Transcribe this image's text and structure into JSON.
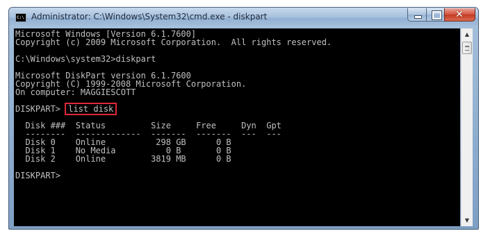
{
  "window": {
    "title": "Administrator: C:\\Windows\\System32\\cmd.exe - diskpart",
    "icon": "cmd-icon",
    "icon_label": "C:\\",
    "controls": {
      "minimize_icon": "minimize-icon",
      "maximize_icon": "maximize-icon",
      "close_icon": "close-icon",
      "close_glyph": "✕"
    }
  },
  "console": {
    "lines": {
      "l1": "Microsoft Windows [Version 6.1.7600]",
      "l2": "Copyright (c) 2009 Microsoft Corporation.  All rights reserved.",
      "l3": "C:\\Windows\\system32>diskpart",
      "l4": "Microsoft DiskPart version 6.1.7600",
      "l5": "Copyright (C) 1999-2008 Microsoft Corporation.",
      "l6": "On computer: MAGGIESCOTT",
      "prompt1": "DISKPART> ",
      "command": "list disk",
      "header": "  Disk ###  Status         Size     Free     Dyn  Gpt",
      "separator": "  --------  -------------  -------  -------  ---  ---",
      "row1": "  Disk 0    Online          298 GB      0 B",
      "row2": "  Disk 1    No Media          0 B       0 B",
      "row3": "  Disk 2    Online         3819 MB      0 B",
      "prompt2": "DISKPART> "
    },
    "colors": {
      "background": "#000000",
      "text": "#c0c0c0",
      "highlight_border": "#e0283c"
    }
  },
  "scrollbar": {
    "up_glyph": "▲",
    "down_glyph": "▼"
  }
}
